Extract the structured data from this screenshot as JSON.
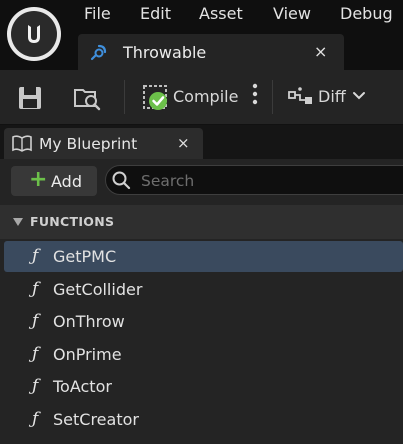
{
  "menu": {
    "file": "File",
    "edit": "Edit",
    "asset": "Asset",
    "view": "View",
    "debug": "Debug"
  },
  "document_tab": {
    "label": "Throwable",
    "close": "×"
  },
  "toolbar": {
    "compile_label": "Compile",
    "more_glyph": "⋮",
    "diff_label": "Diff"
  },
  "panel": {
    "tab_label": "My Blueprint",
    "tab_close": "×",
    "add_label": "Add",
    "add_glyph": "+",
    "search_placeholder": "Search",
    "section_label": "FUNCTIONS",
    "function_glyph": "ƒ",
    "functions": [
      {
        "label": "GetPMC",
        "selected": true
      },
      {
        "label": "GetCollider",
        "selected": false
      },
      {
        "label": "OnThrow",
        "selected": false
      },
      {
        "label": "OnPrime",
        "selected": false
      },
      {
        "label": "ToActor",
        "selected": false
      },
      {
        "label": "SetCreator",
        "selected": false
      }
    ]
  },
  "colors": {
    "accent_green": "#6cc04a",
    "selected_row": "#3a4a5e",
    "panel_bg": "#242424"
  },
  "icons": {
    "logo": "unreal-engine-logo",
    "tab": "blueprint-class-icon",
    "save": "save-icon",
    "browse": "browse-content-icon",
    "compile": "compile-success-icon",
    "diff": "diff-icon",
    "panel_tab": "book-icon",
    "search": "search-icon"
  }
}
